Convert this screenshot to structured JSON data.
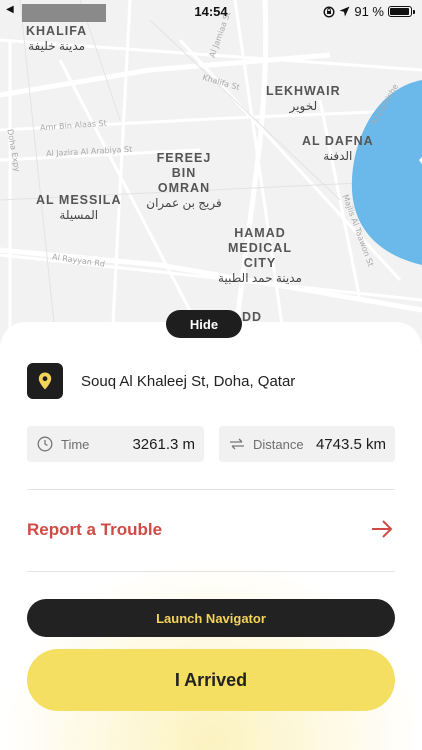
{
  "status_bar": {
    "back_glyph": "◀",
    "time": "14:54",
    "battery_text": "91 %",
    "icons": [
      "screen-lock-rotation-icon",
      "location-arrow-icon",
      "battery-icon"
    ]
  },
  "map": {
    "areas": [
      {
        "en": "KHALIFA",
        "ar": "مدينة خليفة"
      },
      {
        "en": "LEKHWAIR",
        "ar": "لخوير"
      },
      {
        "en": "AL DAFNA",
        "ar": "الدفنة"
      },
      {
        "en": "FEREEJ BIN OMRAN",
        "ar": "فريج بن عمران"
      },
      {
        "en": "AL MESSILA",
        "ar": "المسيلة"
      },
      {
        "en": "HAMAD MEDICAL CITY",
        "ar": "مدينة حمد الطبية"
      },
      {
        "en": "DD",
        "ar": ""
      }
    ],
    "streets": [
      "Al Jamiaa St",
      "Khalifa St",
      "Amr Bin Alaas St",
      "Al Jazira Al Arabiya St",
      "Doha Expy",
      "Al Rayyan Rd",
      "Al Corniche",
      "Majlis Al Taawon St"
    ],
    "colors": {
      "land": "#f2f2f2",
      "water": "#6ab9ea",
      "road": "#ffffff"
    }
  },
  "sheet": {
    "hide_label": "Hide",
    "address": "Souq Al Khaleej St, Doha, Qatar",
    "time_label": "Time",
    "time_value": "3261.3 m",
    "distance_label": "Distance",
    "distance_value": "4743.5 km",
    "report_label": "Report a Trouble",
    "navigator_label": "Launch Navigator",
    "arrived_label": "I Arrived"
  },
  "colors": {
    "accent_yellow": "#f4df63",
    "danger": "#cf4b45",
    "dark": "#1e1e1e"
  }
}
